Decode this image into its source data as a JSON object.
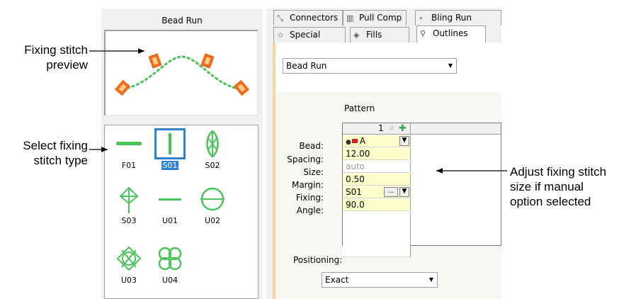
{
  "callouts": {
    "preview": [
      "Fixing stitch",
      "preview"
    ],
    "select": [
      "Select fixing",
      "stitch type"
    ],
    "adjust": [
      "Adjust fixing stitch",
      "size if manual",
      "option selected"
    ]
  },
  "left_panel": {
    "title": "Bead Run",
    "fixing_types": [
      {
        "code": "F01",
        "selected": false
      },
      {
        "code": "S01",
        "selected": true
      },
      {
        "code": "S02",
        "selected": false
      },
      {
        "code": "S03",
        "selected": false
      },
      {
        "code": "U01",
        "selected": false
      },
      {
        "code": "U02",
        "selected": false
      },
      {
        "code": "U03",
        "selected": false
      },
      {
        "code": "U04",
        "selected": false
      }
    ]
  },
  "tabs": {
    "row1": [
      {
        "label": "Connectors",
        "icon": "connectors-icon"
      },
      {
        "label": "Pull Comp",
        "icon": "pull-comp-icon"
      },
      {
        "label": "Bling Run",
        "icon": "bling-run-icon"
      }
    ],
    "row2": [
      {
        "label": "Special",
        "icon": "star-icon"
      },
      {
        "label": "Fills",
        "icon": "fills-icon"
      },
      {
        "label": "Outlines",
        "icon": "outlines-icon",
        "active": true
      }
    ]
  },
  "stitch_type_select": {
    "value": "Bead Run"
  },
  "pattern": {
    "label": "Pattern",
    "column": "1",
    "rows": [
      {
        "label": "Bead:",
        "value": "A"
      },
      {
        "label": "Spacing:",
        "value": "12.00"
      },
      {
        "label": "Size:",
        "value": "auto"
      },
      {
        "label": "Margin:",
        "value": "0.50"
      },
      {
        "label": "Fixing:",
        "value": "S01"
      },
      {
        "label": "Angle:",
        "value": "90.0"
      }
    ],
    "fixing_button": "..."
  },
  "positioning": {
    "label": "Positioning:",
    "value": "Exact"
  },
  "colors": {
    "accent": "#2f80d6",
    "stitch_green": "#49c45a",
    "bead_orange": "#f26b1d",
    "cell_yellow": "#ffffcc"
  }
}
